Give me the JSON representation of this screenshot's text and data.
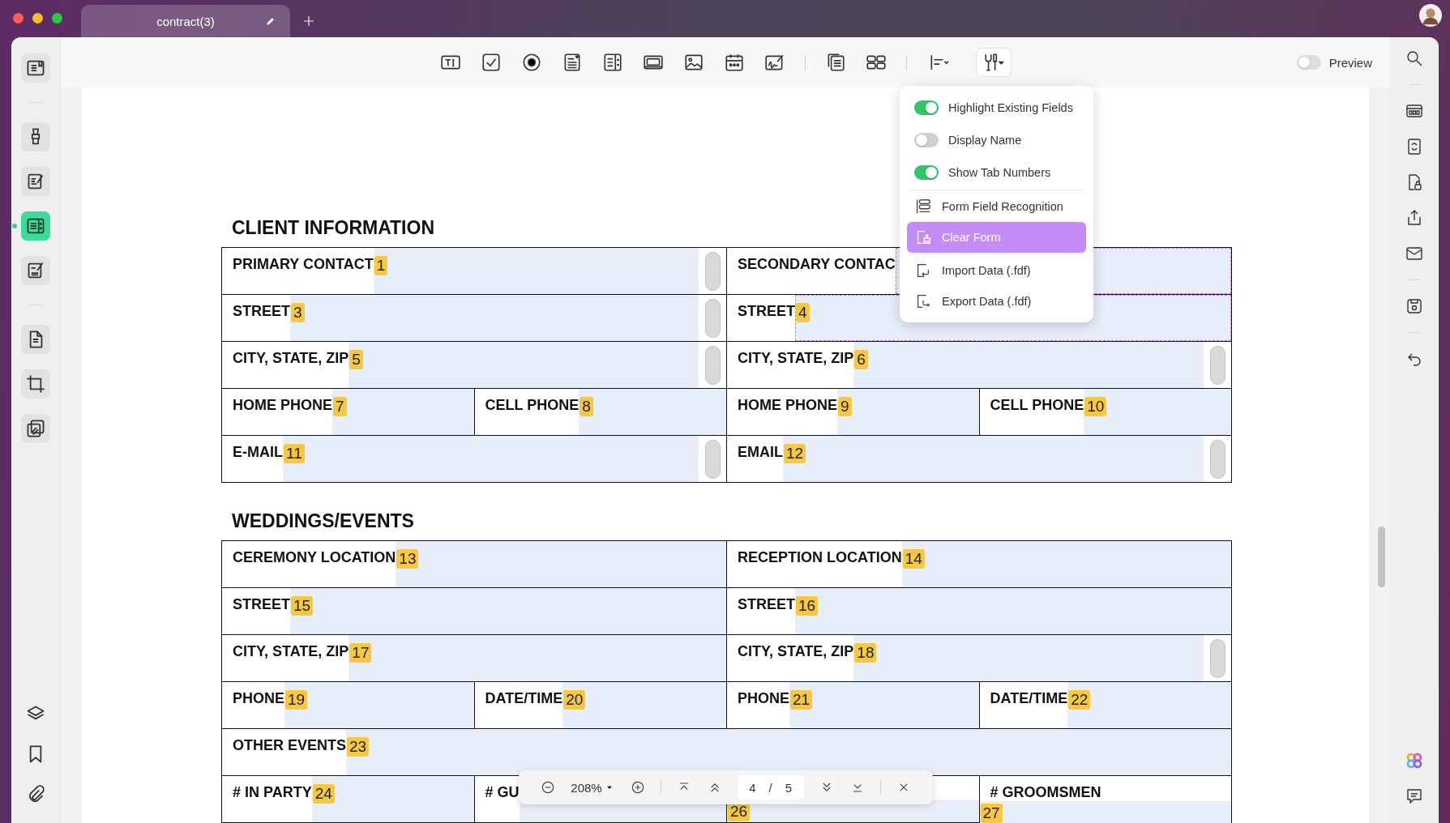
{
  "window": {
    "tabs": [
      {
        "title": "contract(3)",
        "selected": true
      }
    ]
  },
  "toolbar": {
    "tools_active": true,
    "preview": {
      "label": "Preview",
      "on": false
    }
  },
  "left_sidebar": {
    "items": [
      {
        "selected": false
      },
      {
        "selected": false
      },
      {
        "selected": false
      },
      {
        "selected": true
      },
      {
        "selected": false
      },
      {
        "selected": false
      },
      {
        "selected": false
      },
      {
        "selected": false
      }
    ]
  },
  "form_menu": {
    "toggles": [
      {
        "label": "Highlight Existing Fields",
        "on": true
      },
      {
        "label": "Display Name",
        "on": false
      },
      {
        "label": "Show Tab Numbers",
        "on": true
      }
    ],
    "actions": [
      {
        "label": "Form Field Recognition",
        "selected": false
      },
      {
        "label": "Clear Form",
        "selected": true
      },
      {
        "label": "Import Data (.fdf)",
        "selected": false
      },
      {
        "label": "Export Data (.fdf)",
        "selected": false
      }
    ]
  },
  "sections": [
    {
      "heading": "CLIENT INFORMATION",
      "rows": [
        {
          "cells": [
            {
              "kind": "inline",
              "label": "PRIMARY CONTACT",
              "tab": "1",
              "scrollbar": true,
              "selected": false
            },
            {
              "kind": "inline",
              "label": "SECONDARY CONTAC",
              "scrollbar": false,
              "selected": true
            }
          ]
        },
        {
          "cells": [
            {
              "kind": "inline",
              "label": "STREET",
              "tab": "3",
              "scrollbar": true,
              "selected": false
            },
            {
              "kind": "inline",
              "label": "STREET",
              "tab": "4",
              "scrollbar": false,
              "selected": true
            }
          ]
        },
        {
          "cells": [
            {
              "kind": "inline",
              "label": "CITY, STATE, ZIP",
              "tab": "5",
              "scrollbar": true,
              "selected": false
            },
            {
              "kind": "inline",
              "label": "CITY, STATE, ZIP",
              "tab": "6",
              "scrollbar": true,
              "selected": false
            }
          ]
        },
        {
          "cells": [
            {
              "kind": "inline",
              "label": "HOME PHONE",
              "tab": "7",
              "scrollbar": false,
              "selected": false
            },
            {
              "kind": "inline",
              "label": "CELL PHONE",
              "tab": "8",
              "scrollbar": false,
              "selected": false
            },
            {
              "kind": "inline",
              "label": "HOME PHONE",
              "tab": "9",
              "scrollbar": false,
              "selected": false
            },
            {
              "kind": "inline",
              "label": "CELL PHONE",
              "tab": "10",
              "scrollbar": false,
              "selected": false
            }
          ]
        },
        {
          "cells": [
            {
              "kind": "inline",
              "label": "E-MAIL",
              "tab": "11",
              "scrollbar": true,
              "selected": false
            },
            {
              "kind": "inline",
              "label": "EMAIL",
              "tab": "12",
              "scrollbar": true,
              "selected": false
            }
          ]
        }
      ]
    },
    {
      "heading": "WEDDINGS/EVENTS",
      "rows": [
        {
          "cells": [
            {
              "kind": "inline",
              "label": "CEREMONY LOCATION",
              "tab": "13",
              "scrollbar": false,
              "selected": false
            },
            {
              "kind": "inline",
              "label": "RECEPTION LOCATION",
              "tab": "14",
              "scrollbar": false,
              "selected": false
            }
          ]
        },
        {
          "cells": [
            {
              "kind": "inline",
              "label": "STREET",
              "tab": "15",
              "scrollbar": false,
              "selected": false
            },
            {
              "kind": "inline",
              "label": "STREET",
              "tab": "16",
              "scrollbar": false,
              "selected": false
            }
          ]
        },
        {
          "cells": [
            {
              "kind": "inline",
              "label": "CITY, STATE, ZIP",
              "tab": "17",
              "scrollbar": false,
              "selected": false
            },
            {
              "kind": "inline",
              "label": "CITY, STATE, ZIP",
              "tab": "18",
              "scrollbar": true,
              "selected": false
            }
          ]
        },
        {
          "cells": [
            {
              "kind": "inline",
              "label": "PHONE",
              "tab": "19",
              "scrollbar": false,
              "selected": false
            },
            {
              "kind": "inline",
              "label": "DATE/TIME",
              "tab": "20",
              "scrollbar": false,
              "selected": false
            },
            {
              "kind": "inline",
              "label": "PHONE",
              "tab": "21",
              "scrollbar": false,
              "selected": false
            },
            {
              "kind": "inline",
              "label": "DATE/TIME",
              "tab": "22",
              "scrollbar": false,
              "selected": false
            }
          ]
        },
        {
          "cells": [
            {
              "kind": "inline",
              "label": "OTHER EVENTS",
              "tab": "23",
              "scrollbar": false,
              "selected": false
            }
          ]
        },
        {
          "cells": [
            {
              "kind": "inline",
              "label": "# IN PARTY",
              "tab": "24",
              "scrollbar": false,
              "selected": false
            },
            {
              "kind": "inline",
              "label": "# GU",
              "scrollbar": false,
              "selected": false
            },
            {
              "kind": "stacked",
              "tab": "26",
              "scrollbar": false,
              "selected": false
            },
            {
              "kind": "stacked",
              "label": "# GROOMSMEN",
              "tab": "27",
              "scrollbar": false,
              "selected": false
            }
          ]
        }
      ]
    }
  ],
  "zoom_bar": {
    "zoom": "208%",
    "page": "4",
    "page_separator": "/",
    "page_count": "5"
  }
}
